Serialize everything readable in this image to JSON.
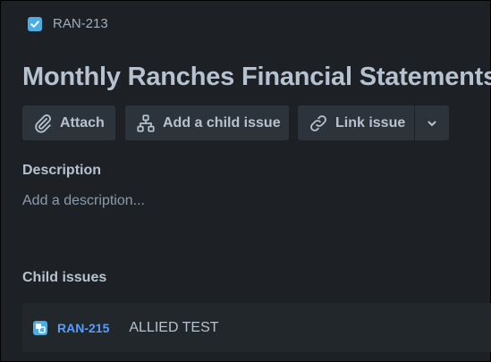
{
  "breadcrumb": {
    "issue_type_icon": "checkbox-task-icon",
    "issue_key": "RAN-213"
  },
  "issue": {
    "title": "Monthly Ranches Financial Statements"
  },
  "toolbar": {
    "attach_label": "Attach",
    "attach_icon": "paperclip-icon",
    "add_child_label": "Add a child issue",
    "add_child_icon": "hierarchy-icon",
    "link_label": "Link issue",
    "link_icon": "link-icon",
    "more_icon": "chevron-down-icon"
  },
  "description": {
    "heading": "Description",
    "placeholder": "Add a description..."
  },
  "child_issues": {
    "heading": "Child issues",
    "items": [
      {
        "icon": "subtask-icon",
        "key": "RAN-215",
        "summary": "ALLIED TEST"
      }
    ]
  },
  "colors": {
    "background": "#1d2125",
    "button_bg": "#2c333a",
    "text": "#b6c2cf",
    "subtle_text": "#8c9bab",
    "link": "#579dff",
    "issue_icon": "#4bade8"
  }
}
